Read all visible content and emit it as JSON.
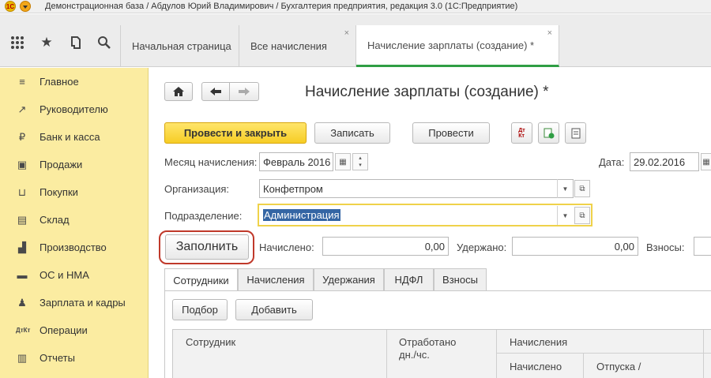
{
  "window": {
    "title": "Демонстрационная база / Абдулов Юрий Владимирович / Бухгалтерия предприятия, редакция 3.0  (1С:Предприятие)"
  },
  "tabs": [
    {
      "label": "Начальная страница"
    },
    {
      "label": "Все начисления",
      "close": "×"
    },
    {
      "label": "Начисление зарплаты (создание) *",
      "close": "×"
    }
  ],
  "sidebar": {
    "items": [
      {
        "label": "Главное",
        "icon": "≡"
      },
      {
        "label": "Руководителю",
        "icon": "↗"
      },
      {
        "label": "Банк и касса",
        "icon": "₽"
      },
      {
        "label": "Продажи",
        "icon": "▣"
      },
      {
        "label": "Покупки",
        "icon": "⊔"
      },
      {
        "label": "Склад",
        "icon": "▤"
      },
      {
        "label": "Производство",
        "icon": "▟"
      },
      {
        "label": "ОС и НМА",
        "icon": "▬"
      },
      {
        "label": "Зарплата и кадры",
        "icon": "♟"
      },
      {
        "label": "Операции",
        "icon": "ДтКт"
      },
      {
        "label": "Отчеты",
        "icon": "▥"
      }
    ]
  },
  "form": {
    "title": "Начисление зарплаты (создание) *",
    "toolbar": {
      "post_close": "Провести и закрыть",
      "save": "Записать",
      "post": "Провести"
    },
    "month_label": "Месяц начисления:",
    "month_value": "Февраль 2016",
    "date_label": "Дата:",
    "date_value": "29.02.2016",
    "org_label": "Организация:",
    "org_value": "Конфетпром",
    "dept_label": "Подразделение:",
    "dept_value": "Администрация",
    "fill_button": "Заполнить",
    "accrued_label": "Начислено:",
    "accrued_value": "0,00",
    "withheld_label": "Удержано:",
    "withheld_value": "0,00",
    "contrib_label": "Взносы:"
  },
  "subtabs": [
    {
      "label": "Сотрудники"
    },
    {
      "label": "Начисления"
    },
    {
      "label": "Удержания"
    },
    {
      "label": "НДФЛ"
    },
    {
      "label": "Взносы"
    }
  ],
  "employees_panel": {
    "select_button": "Подбор",
    "add_button": "Добавить",
    "columns": {
      "employee": "Сотрудник",
      "worked_line1": "Отработано",
      "worked_line2": "дн./чс.",
      "accruals_group": "Начисления",
      "accrued": "Начислено",
      "vacation": "Отпуска /"
    }
  },
  "colors": {
    "sidebar_bg": "#fbeca1",
    "primary_button": "#f6cd25",
    "active_tab_accent": "#2f9e44",
    "highlight_outline": "#c0392b"
  }
}
